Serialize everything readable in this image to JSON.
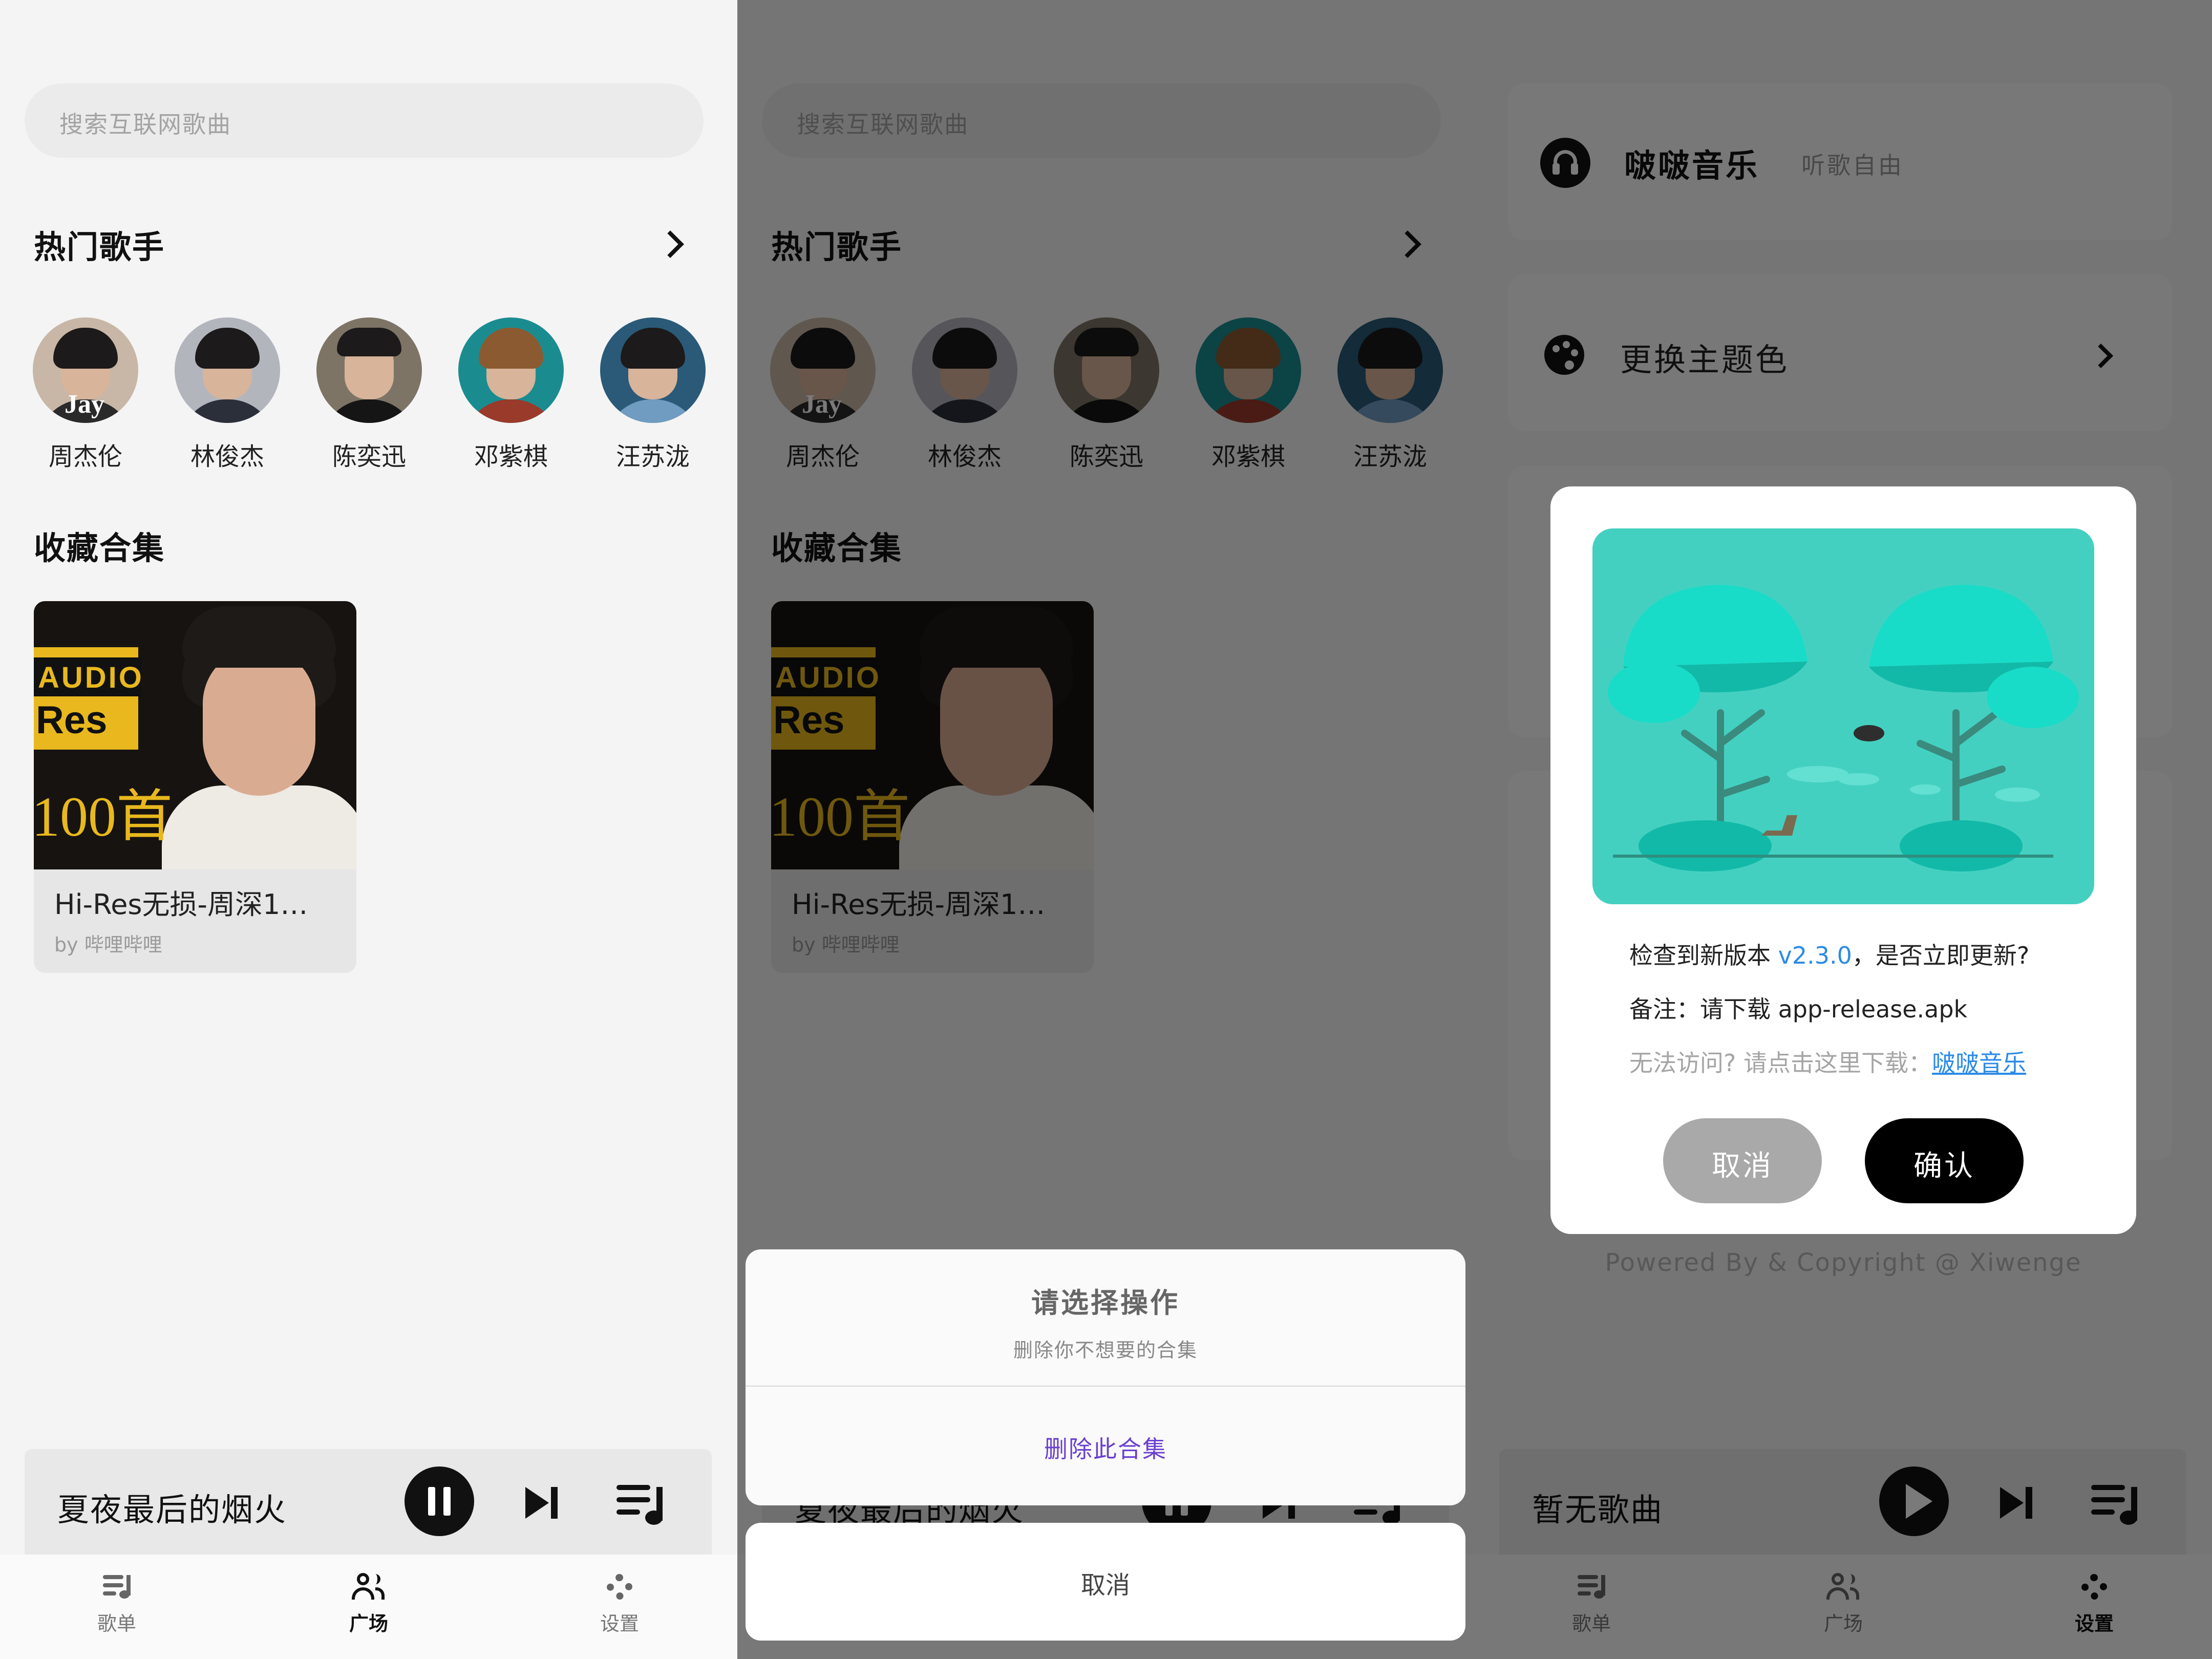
{
  "search": {
    "placeholder": "搜索互联网歌曲"
  },
  "sections": {
    "hot_artists": "热门歌手",
    "collections": "收藏合集"
  },
  "artists": [
    {
      "name": "周杰伦",
      "badge": "Jay"
    },
    {
      "name": "林俊杰"
    },
    {
      "name": "陈奕迅"
    },
    {
      "name": "邓紫棋"
    },
    {
      "name": "汪苏泷"
    }
  ],
  "collection": {
    "title": "Hi-Res无损-周深1…",
    "by": "by 哔哩哔哩",
    "cover_text": {
      "hires": "Hi-Res",
      "audio": "AUDIO",
      "count": "100首"
    }
  },
  "player": {
    "now_playing": "夏夜最后的烟火",
    "empty": "暂无歌曲"
  },
  "nav": {
    "tabs": [
      "歌单",
      "广场",
      "设置"
    ]
  },
  "action_sheet": {
    "title": "请选择操作",
    "subtitle": "删除你不想要的合集",
    "action": "删除此合集",
    "cancel": "取消"
  },
  "settings": {
    "app_name": "啵啵音乐",
    "app_slogan": "听歌自由",
    "theme_item": "更换主题色",
    "footer": "Powered By & Copyright @ Xiwenge"
  },
  "update_dialog": {
    "line1_prefix": "检查到新版本 ",
    "version": "v2.3.0",
    "line1_suffix": "，是否立即更新?",
    "line2": "备注：请下载 app-release.apk",
    "line3_prefix": "无法访问? 请点击这里下载：",
    "link": "啵啵音乐",
    "cancel": "取消",
    "confirm": "确认"
  },
  "colors": {
    "accent_link": "#2b8be6",
    "action_purple": "#6a3fd0",
    "illustration": "#44d0c0",
    "tree": "#1fe0cc"
  }
}
